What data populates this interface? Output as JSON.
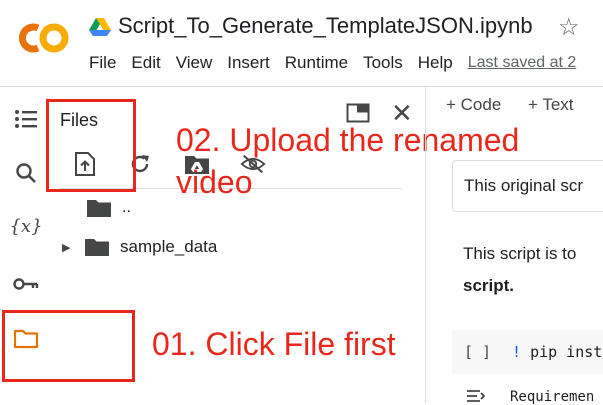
{
  "header": {
    "notebook_title": "Script_To_Generate_TemplateJSON.ipynb",
    "menu": [
      "File",
      "Edit",
      "View",
      "Insert",
      "Runtime",
      "Tools",
      "Help"
    ],
    "last_saved": "Last saved at 2"
  },
  "rail": {
    "vars_label": "{x}"
  },
  "files_panel": {
    "title": "Files",
    "parent_dir": "..",
    "folders": [
      "sample_data"
    ]
  },
  "annotations": {
    "upload_line1": "02. Upload the renamed",
    "upload_line2": "video",
    "files": "01. Click File first"
  },
  "notebook": {
    "add_code": "+ Code",
    "add_text": "+ Text",
    "text_cell": "This original scr",
    "desc_line1": "This script is to",
    "desc_line2": "script.",
    "code_bracket": "[ ]",
    "code_bang": "!",
    "code_rest": "pip inst",
    "output": "Requiremen"
  },
  "colors": {
    "annotation_red": "#e8281d",
    "logo_orange": "#f9ab00",
    "logo_dark_orange": "#e8710a",
    "files_icon_orange": "#e37400",
    "link_blue": "#0b57d0"
  }
}
